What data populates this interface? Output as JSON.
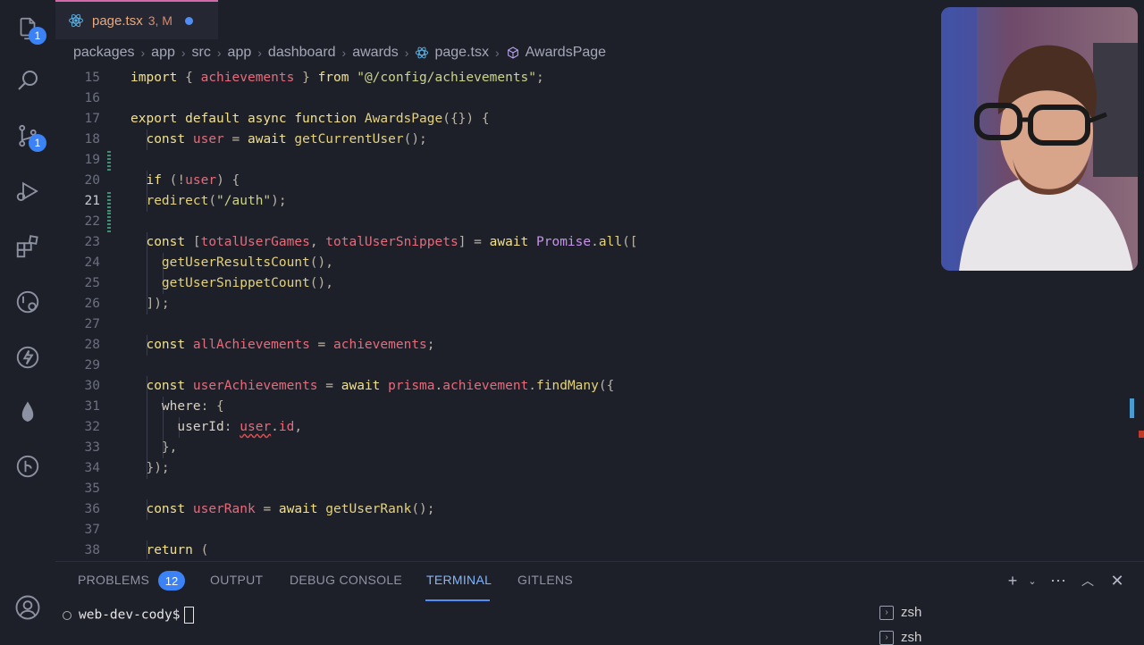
{
  "colors": {
    "accent": "#3b82f6",
    "tab_border": "#d26aa9",
    "git_modified": "#3f8f74"
  },
  "activity": {
    "items": [
      {
        "icon": "files-icon",
        "badge": "1"
      },
      {
        "icon": "search-icon"
      },
      {
        "icon": "source-control-icon",
        "badge": "1"
      },
      {
        "icon": "run-debug-icon"
      },
      {
        "icon": "extensions-icon"
      },
      {
        "icon": "remote-explorer-icon"
      },
      {
        "icon": "thunder-client-icon"
      },
      {
        "icon": "mongodb-icon"
      },
      {
        "icon": "gitlens-icon"
      },
      {
        "icon": "account-icon"
      }
    ]
  },
  "tab": {
    "name": "page.tsx",
    "meta": "3, M"
  },
  "breadcrumb": [
    "packages",
    "app",
    "src",
    "app",
    "dashboard",
    "awards",
    "page.tsx",
    "AwardsPage"
  ],
  "editor": {
    "lines": [
      {
        "n": "15",
        "html": "<span class='kw'>import</span> <span class='punc'>{</span> <span class='var'>achievements</span> <span class='punc'>}</span> <span class='kw'>from</span> <span class='str'>\"@/config/achievements\"</span><span class='punc'>;</span>"
      },
      {
        "n": "16",
        "html": ""
      },
      {
        "n": "17",
        "html": "<span class='kw'>export default async function</span> <span class='fn'>AwardsPage</span><span class='punc'>({}) {</span>"
      },
      {
        "n": "18",
        "html": "  <span class='kw'>const</span> <span class='var'>user</span> <span class='punc'>=</span> <span class='kw'>await</span> <span class='fn'>getCurrentUser</span><span class='punc'>();</span>"
      },
      {
        "n": "19",
        "html": ""
      },
      {
        "n": "20",
        "html": "  <span class='kw'>if</span> <span class='punc'>(!</span><span class='var'>user</span><span class='punc'>) {</span>"
      },
      {
        "n": "21",
        "html": "  <span class='fn'>redirect</span><span class='punc'>(</span><span class='str'>\"/auth\"</span><span class='punc'>);</span>"
      },
      {
        "n": "22",
        "html": ""
      },
      {
        "n": "23",
        "html": "  <span class='kw'>const</span> <span class='punc'>[</span><span class='var'>totalUserGames</span><span class='punc'>,</span> <span class='var'>totalUserSnippets</span><span class='punc'>]</span> <span class='punc'>=</span> <span class='kw'>await</span> <span class='type'>Promise</span><span class='punc'>.</span><span class='fn'>all</span><span class='punc'>([</span>"
      },
      {
        "n": "24",
        "html": "    <span class='fn'>getUserResultsCount</span><span class='punc'>(),</span>"
      },
      {
        "n": "25",
        "html": "    <span class='fn'>getUserSnippetCount</span><span class='punc'>(),</span>"
      },
      {
        "n": "26",
        "html": "  <span class='punc'>]);</span>"
      },
      {
        "n": "27",
        "html": ""
      },
      {
        "n": "28",
        "html": "  <span class='kw'>const</span> <span class='var'>allAchievements</span> <span class='punc'>=</span> <span class='var'>achievements</span><span class='punc'>;</span>"
      },
      {
        "n": "29",
        "html": ""
      },
      {
        "n": "30",
        "html": "  <span class='kw'>const</span> <span class='var'>userAchievements</span> <span class='punc'>=</span> <span class='kw'>await</span> <span class='var'>prisma</span><span class='punc'>.</span><span class='var'>achievement</span><span class='punc'>.</span><span class='fn'>findMany</span><span class='punc'>({</span>"
      },
      {
        "n": "31",
        "html": "    <span class='prop'>where</span><span class='punc'>: {</span>"
      },
      {
        "n": "32",
        "html": "      <span class='prop'>userId</span><span class='punc'>:</span> <span class='var err'>user</span><span class='punc'>.</span><span class='var'>id</span><span class='punc'>,</span>"
      },
      {
        "n": "33",
        "html": "    <span class='punc'>},</span>"
      },
      {
        "n": "34",
        "html": "  <span class='punc'>});</span>"
      },
      {
        "n": "35",
        "html": ""
      },
      {
        "n": "36",
        "html": "  <span class='kw'>const</span> <span class='var'>userRank</span> <span class='punc'>=</span> <span class='kw'>await</span> <span class='fn'>getUserRank</span><span class='punc'>();</span>"
      },
      {
        "n": "37",
        "html": ""
      },
      {
        "n": "38",
        "html": "  <span class='kw'>return</span> <span class='punc'>(</span>"
      }
    ]
  },
  "panel": {
    "tabs": [
      "PROBLEMS",
      "OUTPUT",
      "DEBUG CONSOLE",
      "TERMINAL",
      "GITLENS"
    ],
    "problems_count": "12",
    "active_tab": "TERMINAL",
    "prompt": "web-dev-cody$",
    "terminals": [
      "zsh",
      "zsh"
    ]
  }
}
